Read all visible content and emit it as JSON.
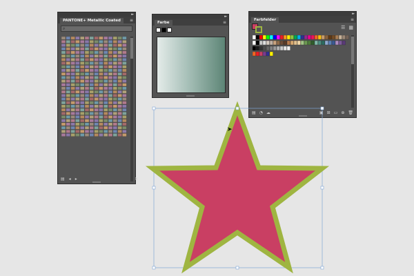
{
  "panels": {
    "pantone": {
      "title": "PANTONE+ Metallic Coated",
      "search_placeholder": ""
    },
    "farbe": {
      "title": "Farbe"
    },
    "farbfelder": {
      "title": "Farbfelder"
    }
  },
  "icons": {
    "menu": "hamburger-menu-icon",
    "search": "search-icon",
    "library": "library-menu-icon",
    "prev": "previous-arrow-icon",
    "next": "next-arrow-icon",
    "close": "close-icon",
    "list_view": "list-view-icon",
    "grid_view": "grid-view-icon"
  },
  "colors": {
    "star_fill": "#c93f63",
    "star_stroke": "#9fb541",
    "selection": "#7fa6d6",
    "panel_bg": "#535353"
  },
  "farbe": {
    "mini_swatches": [
      "#ffffff",
      "#000000",
      "#ffffff"
    ]
  },
  "farbfelder": {
    "swatch_rows": [
      [
        "#ffffff",
        "#000000",
        "#ff0000",
        "#ffff00",
        "#00ff00",
        "#00ffff",
        "#0000ff",
        "#ff00ff",
        "#ed1c24",
        "#f7941d",
        "#fff200",
        "#8dc63f",
        "#00a651",
        "#00aeef",
        "#2e3192",
        "#92278f",
        "#ec008c",
        "#ed145b",
        "#f26522",
        "#ffc20e",
        "#c69c6d",
        "#8c6239",
        "#603913",
        "#754c24",
        "#a67c52",
        "#c7b299",
        "#998675",
        "#736357"
      ],
      [
        "#ffffff",
        "#000000",
        "#c8c8c8",
        "#e0e0e0",
        "#d6ccc2",
        "#c0b2a5",
        "#c9a27e",
        "#8e6b4a",
        "#6d4c36",
        "#5a3b28",
        "#b87a4b",
        "#d7a86e",
        "#e2c08d",
        "#f1d8a8",
        "#a3c586",
        "#6c9a52",
        "#4e7c3a",
        "#2f5e2b",
        "#7fb8a8",
        "#4c8e80",
        "#2c6b61",
        "#8ea9d1",
        "#5b7fb5",
        "#3a5a92",
        "#ad8ac0",
        "#7d5a9b",
        "#5a3a78"
      ],
      [
        "#000000",
        "#1a1a1a",
        "#333333",
        "#4d4d4d",
        "#666666",
        "#808080",
        "#999999",
        "#b3b3b3",
        "#cccccc",
        "#e6e6e6",
        "#f2f2f2"
      ],
      [
        "#f26522",
        "#ed1c24",
        "#c93f63",
        "#7a3b8f",
        "#2e3192",
        "#fff200"
      ]
    ]
  },
  "pantone": {
    "rows": 28,
    "cols": 14,
    "palette": [
      "#9b8a7a",
      "#b07a8c",
      "#8a77a8",
      "#6f86b0",
      "#7fa39b",
      "#a7a06a",
      "#b68a5f",
      "#a36a6a",
      "#7c8c6a",
      "#8f7ba8",
      "#c49a6c",
      "#6f9aa8",
      "#b0a07a",
      "#a87a9b"
    ]
  }
}
